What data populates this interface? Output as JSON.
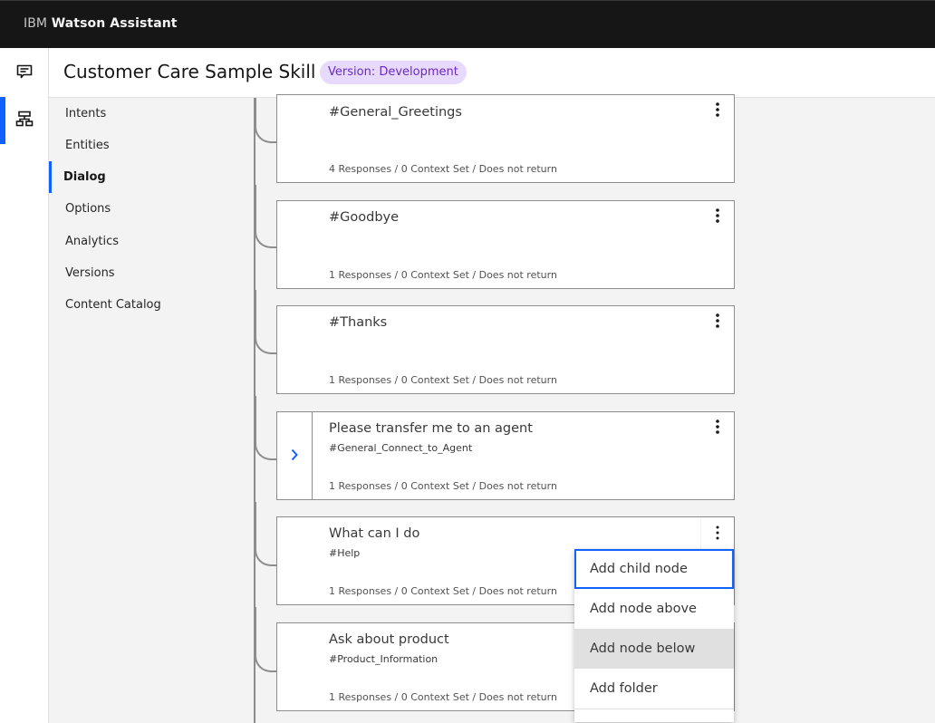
{
  "app": {
    "brand_prefix": "IBM",
    "brand_name": "Watson Assistant"
  },
  "rail": {
    "items": [
      {
        "icon": "chat-icon",
        "label": "Assistants",
        "active": false
      },
      {
        "icon": "skills-icon",
        "label": "Skills",
        "active": true
      }
    ]
  },
  "header": {
    "title": "Customer Care Sample Skill",
    "version_badge": "Version: Development"
  },
  "sidebar": {
    "items": [
      {
        "label": "Intents",
        "active": false
      },
      {
        "label": "Entities",
        "active": false
      },
      {
        "label": "Dialog",
        "active": true
      },
      {
        "label": "Options",
        "active": false
      },
      {
        "label": "Analytics",
        "active": false
      },
      {
        "label": "Versions",
        "active": false
      },
      {
        "label": "Content Catalog",
        "active": false
      }
    ]
  },
  "dialog": {
    "nodes": [
      {
        "name": "#General_Greetings",
        "condition": "",
        "meta": "4 Responses / 0 Context Set / Does not return",
        "has_children": false
      },
      {
        "name": "#Goodbye",
        "condition": "",
        "meta": "1 Responses / 0 Context Set / Does not return",
        "has_children": false
      },
      {
        "name": "#Thanks",
        "condition": "",
        "meta": "1 Responses / 0 Context Set / Does not return",
        "has_children": false
      },
      {
        "name": "Please transfer me to an agent",
        "condition": "#General_Connect_to_Agent",
        "meta": "1 Responses / 0 Context Set / Does not return",
        "has_children": true
      },
      {
        "name": "What can I do",
        "condition": "#Help",
        "meta": "1 Responses / 0 Context Set / Does not return",
        "has_children": false,
        "menu_open": true
      },
      {
        "name": "Ask about product",
        "condition": "#Product_Information",
        "meta": "1 Responses / 0 Context Set / Does not return",
        "has_children": false
      }
    ]
  },
  "node_menu": {
    "items": [
      {
        "label": "Add child node",
        "state": "focused"
      },
      {
        "label": "Add node above",
        "state": ""
      },
      {
        "label": "Add node below",
        "state": "hover"
      },
      {
        "label": "Add folder",
        "state": ""
      }
    ]
  },
  "colors": {
    "accent": "#0f62fe",
    "badge_bg": "#e8daff",
    "badge_text": "#6929c4",
    "topbar": "#161616"
  }
}
